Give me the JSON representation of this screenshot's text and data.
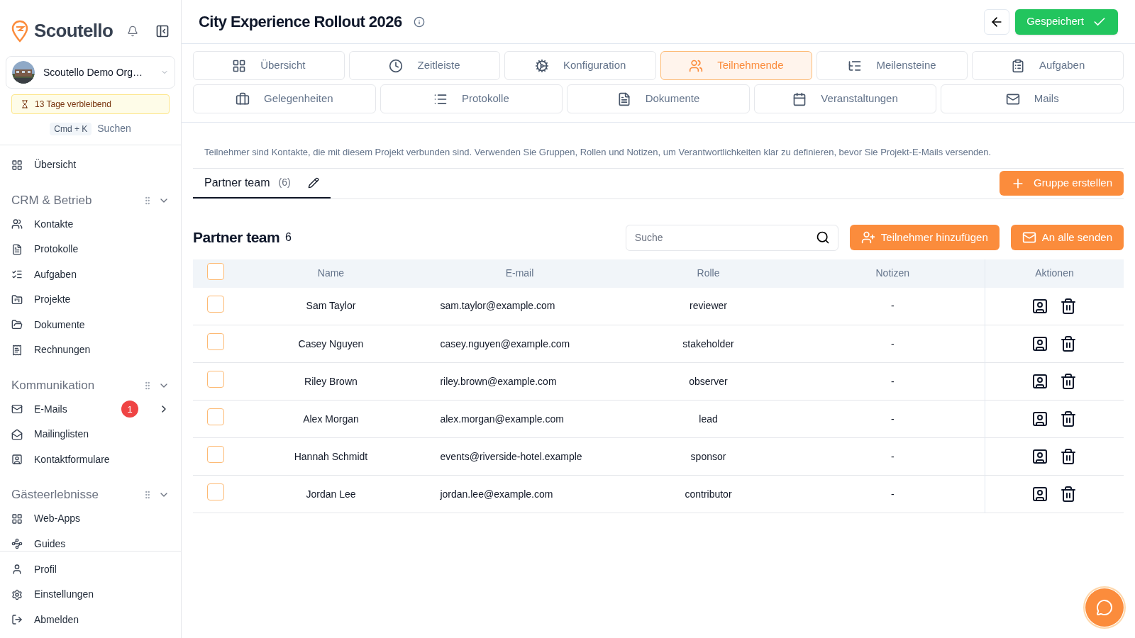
{
  "sidebar": {
    "brand": "Scoutello",
    "org": "Scoutello Demo Org…",
    "trial": "13 Tage verbleibend",
    "shortcut": "Cmd + K",
    "search_label": "Suchen",
    "top_items": [
      {
        "label": "Übersicht"
      }
    ],
    "sections": [
      {
        "title": "CRM & Betrieb",
        "expanded": true,
        "items": [
          {
            "label": "Kontakte"
          },
          {
            "label": "Protokolle"
          },
          {
            "label": "Aufgaben"
          },
          {
            "label": "Projekte"
          },
          {
            "label": "Dokumente"
          },
          {
            "label": "Rechnungen"
          }
        ]
      },
      {
        "title": "Kommunikation",
        "expanded": true,
        "items": [
          {
            "label": "E-Mails",
            "badge": "1",
            "has_submenu": true
          },
          {
            "label": "Mailinglisten"
          },
          {
            "label": "Kontaktformulare"
          }
        ]
      },
      {
        "title": "Gästeerlebnisse",
        "expanded": true,
        "items": [
          {
            "label": "Web-Apps"
          },
          {
            "label": "Guides"
          }
        ]
      }
    ],
    "bottom_items": [
      {
        "label": "Profil"
      },
      {
        "label": "Einstellungen"
      },
      {
        "label": "Abmelden"
      }
    ]
  },
  "header": {
    "title": "City Experience Rollout 2026",
    "save_button": "Gespeichert"
  },
  "tab_rows": [
    [
      {
        "label": "Übersicht",
        "selected": false
      },
      {
        "label": "Zeitleiste",
        "selected": false
      },
      {
        "label": "Konfiguration",
        "selected": false
      },
      {
        "label": "Teilnehmende",
        "selected": true
      },
      {
        "label": "Meilensteine",
        "selected": false
      },
      {
        "label": "Aufgaben",
        "selected": false
      }
    ],
    [
      {
        "label": "Gelegenheiten",
        "selected": false
      },
      {
        "label": "Protokolle",
        "selected": false
      },
      {
        "label": "Dokumente",
        "selected": false
      },
      {
        "label": "Veranstaltungen",
        "selected": false
      },
      {
        "label": "Mails",
        "selected": false
      }
    ]
  ],
  "description": "Teilnehmer sind Kontakte, die mit diesem Projekt verbunden sind. Verwenden Sie Gruppen, Rollen und Notizen, um Verantwortlichkeiten klar zu definieren, bevor Sie Projekt-E-Mails versenden.",
  "group_tabs": [
    {
      "label": "Partner team",
      "count": "(6)",
      "selected": true
    }
  ],
  "create_group_button": "Gruppe erstellen",
  "group": {
    "title": "Partner team",
    "count": "6",
    "search_placeholder": "Suche",
    "add_button": "Teilnehmer hinzufügen",
    "send_button": "An alle senden"
  },
  "table": {
    "all_checked": false,
    "columns": [
      "Name",
      "E-mail",
      "Rolle",
      "Notizen",
      "Aktionen"
    ],
    "rows": [
      {
        "checked": false,
        "name": "Sam Taylor",
        "email": "sam.taylor@example.com",
        "role": "reviewer",
        "notes": "-"
      },
      {
        "checked": false,
        "name": "Casey Nguyen",
        "email": "casey.nguyen@example.com",
        "role": "stakeholder",
        "notes": "-"
      },
      {
        "checked": false,
        "name": "Riley Brown",
        "email": "riley.brown@example.com",
        "role": "observer",
        "notes": "-"
      },
      {
        "checked": false,
        "name": "Alex Morgan",
        "email": "alex.morgan@example.com",
        "role": "lead",
        "notes": "-"
      },
      {
        "checked": false,
        "name": "Hannah Schmidt",
        "email": "events@riverside-hotel.example",
        "role": "sponsor",
        "notes": "-"
      },
      {
        "checked": false,
        "name": "Jordan Lee",
        "email": "jordan.lee@example.com",
        "role": "contributor",
        "notes": "-"
      }
    ]
  }
}
